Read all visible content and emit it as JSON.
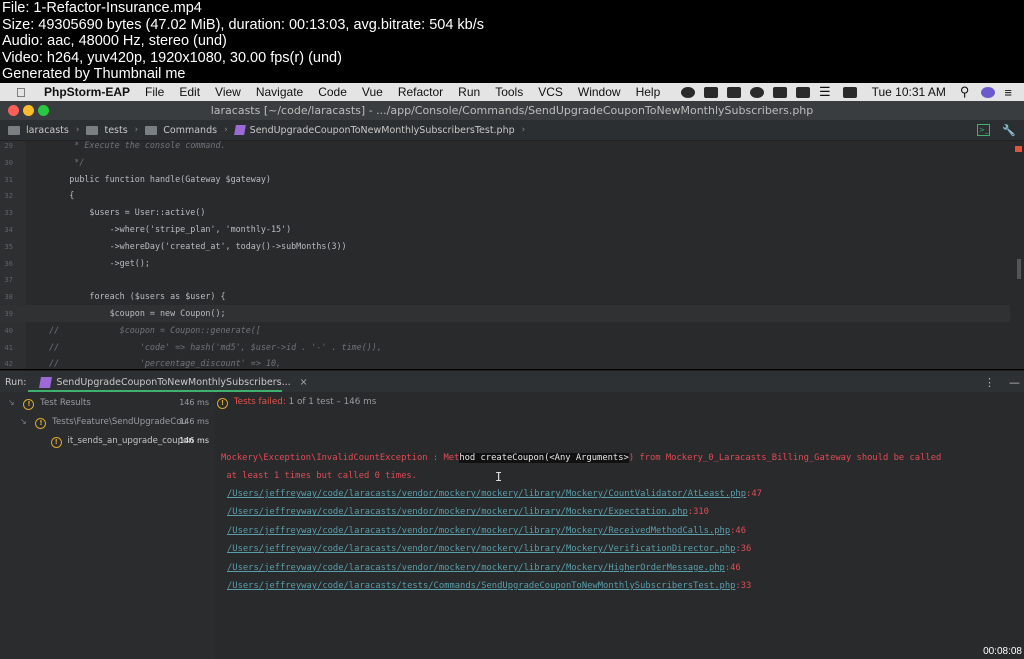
{
  "thumbnail": {
    "lines": [
      "File: 1-Refactor-Insurance.mp4",
      "Size: 49305690 bytes (47.02 MiB), duration: 00:13:03, avg.bitrate: 504 kb/s",
      "Audio: aac, 48000 Hz, stereo (und)",
      "Video: h264, yuv420p, 1920x1080, 30.00 fps(r) (und)",
      "Generated by Thumbnail me"
    ],
    "timestamp": "00:08:08"
  },
  "menubar": {
    "app_name": "PhpStorm-EAP",
    "items": [
      "File",
      "Edit",
      "View",
      "Navigate",
      "Code",
      "Vue",
      "Refactor",
      "Run",
      "Tools",
      "VCS",
      "Window",
      "Help"
    ],
    "clock": "Tue 10:31 AM"
  },
  "window": {
    "title": "laracasts [~/code/laracasts] - .../app/Console/Commands/SendUpgradeCouponToNewMonthlySubscribers.php"
  },
  "breadcrumb": {
    "items": [
      "laracasts",
      "tests",
      "Commands",
      "SendUpgradeCouponToNewMonthlySubscribersTest.php"
    ]
  },
  "editor": {
    "lines": [
      {
        "num": "29",
        "code": "       * Execute the console command.",
        "comment": true
      },
      {
        "num": "30",
        "code": "       */",
        "comment": true
      },
      {
        "num": "31",
        "code": "      public function handle(Gateway $gateway)",
        "comment": false
      },
      {
        "num": "32",
        "code": "      {",
        "comment": false
      },
      {
        "num": "33",
        "code": "          $users = User::active()",
        "comment": false
      },
      {
        "num": "34",
        "code": "              ->where('stripe_plan', 'monthly-15')",
        "comment": false
      },
      {
        "num": "35",
        "code": "              ->whereDay('created_at', today()->subMonths(3))",
        "comment": false
      },
      {
        "num": "36",
        "code": "              ->get();",
        "comment": false
      },
      {
        "num": "37",
        "code": "",
        "comment": false
      },
      {
        "num": "38",
        "code": "          foreach ($users as $user) {",
        "comment": false
      },
      {
        "num": "39",
        "code": "              $coupon = new Coupon();",
        "comment": false
      },
      {
        "num": "40",
        "code": "  //            $coupon = Coupon::generate([",
        "comment": true
      },
      {
        "num": "41",
        "code": "  //                'code' => hash('md5', $user->id . '-' . time()),",
        "comment": true
      },
      {
        "num": "42",
        "code": "  //                'percentage_discount' => 10,",
        "comment": true
      }
    ]
  },
  "run_panel": {
    "label": "Run:",
    "tab": "SendUpgradeCouponToNewMonthlySubscribers...",
    "tree": [
      {
        "name": "Test Results",
        "time": "146 ms"
      },
      {
        "name": "Tests\\Feature\\SendUpgradeCou",
        "time": "146 ms"
      },
      {
        "name": "it_sends_an_upgrade_coupon",
        "time": "146 ms"
      }
    ],
    "status": {
      "failed": "Tests failed:",
      "rest": "1 of 1 test – 146 ms"
    },
    "console": {
      "error_1a": "Mockery\\Exception\\InvalidCountException : Met",
      "error_1b": "hod createCoupon(<Any Arguments>",
      "error_1c": ") from Mockery_0_Laracasts_Billing_Gateway should be called",
      "error_2": " at least 1 times but called 0 times.",
      "trace": [
        {
          "path": "/Users/jeffreyway/code/laracasts/vendor/mockery/mockery/library/Mockery/CountValidator/AtLeast.php",
          "line": ":47"
        },
        {
          "path": "/Users/jeffreyway/code/laracasts/vendor/mockery/mockery/library/Mockery/Expectation.php",
          "line": ":310"
        },
        {
          "path": "/Users/jeffreyway/code/laracasts/vendor/mockery/mockery/library/Mockery/ReceivedMethodCalls.php",
          "line": ":46"
        },
        {
          "path": "/Users/jeffreyway/code/laracasts/vendor/mockery/mockery/library/Mockery/VerificationDirector.php",
          "line": ":36"
        },
        {
          "path": "/Users/jeffreyway/code/laracasts/vendor/mockery/mockery/library/Mockery/HigherOrderMessage.php",
          "line": ":46"
        },
        {
          "path": "/Users/jeffreyway/code/laracasts/tests/Commands/SendUpgradeCouponToNewMonthlySubscribersTest.php",
          "line": ":33"
        }
      ]
    }
  },
  "colors": {
    "error_red": "#e24b55",
    "link_teal": "#5a9eab",
    "accent_green": "#3fb16e",
    "warning_amber": "#d9a72f"
  }
}
